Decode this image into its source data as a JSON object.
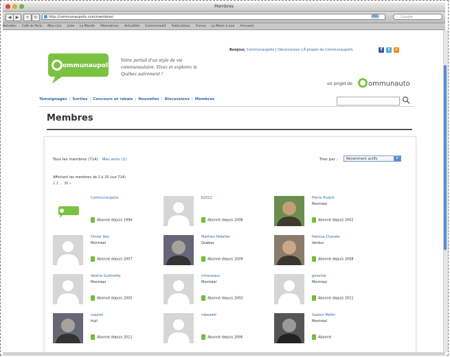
{
  "window": {
    "title": "Membres"
  },
  "browser": {
    "url": "http://communaupolis.com/membres/",
    "rss_label": "RSS",
    "search_placeholder": "Google",
    "bookmarks": [
      "Netvibes",
      "Café de Paris",
      "Mon coin",
      "Liste",
      "Le Monde",
      "Alternatives",
      "Actualités",
      "Communauté",
      "Publications",
      "France",
      "La Marie à Lise",
      "Annuaire"
    ]
  },
  "header": {
    "logo_text": "ommunaupolis",
    "tagline": "Votre portail d'un style de vie communautaire. Vivez et explorez le Québec autrement !",
    "greeting": "Bonjour,",
    "user_name": "Communaupolis",
    "logout": "Déconnexion",
    "about": "À propos de Communaupolis",
    "social": {
      "facebook": "f",
      "twitter": "t",
      "rss": "r"
    },
    "projet_label": "un projet de",
    "projet_logo": "ommunauto"
  },
  "nav": {
    "items": [
      "Témoignages",
      "Sorties",
      "Concours et rabais",
      "Nouvelles",
      "Discussions",
      "Membres"
    ],
    "separator": "|"
  },
  "main": {
    "title": "Membres",
    "tab_all": "Tous les membres (714)",
    "tab_friends": "Mes amis (2)",
    "sort_label": "Trier par :",
    "sort_value": "Récemment actifs",
    "count_text": "Affichant les membres de 1 à 20 (sur 714)",
    "pager": "1 2 ... 36 »"
  },
  "members": [
    {
      "name": "Communaupolis",
      "city": "",
      "since": "Abonné depuis 1994",
      "avatar": "logo"
    },
    {
      "name": "b2012",
      "city": "",
      "since": "Abonné depuis 2008",
      "avatar": "default"
    },
    {
      "name": "Pierre Rivard",
      "city": "Montréal",
      "since": "Abonné depuis 2002",
      "avatar": "photo"
    },
    {
      "name": "Olivier Roy",
      "city": "Montréal",
      "since": "Abonné depuis 2007",
      "avatar": "default"
    },
    {
      "name": "Mathieu Pelletier",
      "city": "Québec",
      "since": "Abonné depuis 2009",
      "avatar": "photo"
    },
    {
      "name": "Patricia Chanele",
      "city": "Verdun",
      "since": "Abonné depuis 2008",
      "avatar": "photo"
    },
    {
      "name": "Valérie Guilmette",
      "city": "Montréal",
      "since": "Abonné depuis 2005",
      "avatar": "default"
    },
    {
      "name": "mtreveaux",
      "city": "Montréal",
      "since": "Abonné depuis 2002",
      "avatar": "default"
    },
    {
      "name": "gmontel",
      "city": "Montréal",
      "since": "Abonné depuis 2011",
      "avatar": "default"
    },
    {
      "name": "caserel",
      "city": "Hull",
      "since": "Abonné depuis 2011",
      "avatar": "photo"
    },
    {
      "name": "mbeadel",
      "city": "",
      "since": "Abonné depuis 2006",
      "avatar": "default"
    },
    {
      "name": "Gaston Mellin",
      "city": "Montréal",
      "since": "Abonné",
      "avatar": "photo"
    }
  ],
  "colors": {
    "accent_green": "#6fbf3a",
    "link_blue": "#2a6aa5",
    "scroll_blue": "#5a8fd8"
  }
}
